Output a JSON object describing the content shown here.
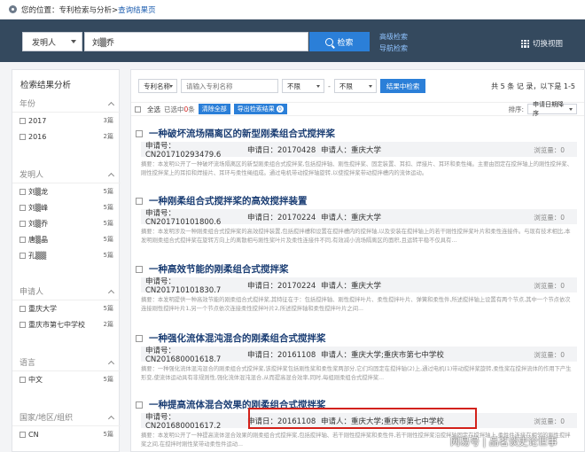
{
  "breadcrumb": {
    "prefix": "您的位置：专利检索与分析>",
    "current": "查询结果页"
  },
  "search": {
    "field": "发明人",
    "query": "刘▒乔",
    "button": "检索",
    "advanced": "高级检索",
    "nav": "导航检索",
    "switch_view": "切换视图"
  },
  "sidebar": {
    "title": "检索结果分析",
    "sections": [
      {
        "name": "年份",
        "items": [
          {
            "label": "2017",
            "count": "3篇"
          },
          {
            "label": "2016",
            "count": "2篇"
          }
        ]
      },
      {
        "name": "发明人",
        "items": [
          {
            "label": "刘▒龙",
            "count": "5篇"
          },
          {
            "label": "刘▒峰",
            "count": "5篇"
          },
          {
            "label": "刘▒乔",
            "count": "5篇"
          },
          {
            "label": "唐▒晶",
            "count": "5篇"
          },
          {
            "label": "孔▒▒",
            "count": "5篇"
          }
        ]
      },
      {
        "name": "申请人",
        "items": [
          {
            "label": "重庆大学",
            "count": "5篇"
          },
          {
            "label": "重庆市第七中学校",
            "count": "2篇"
          }
        ]
      },
      {
        "name": "语言",
        "items": [
          {
            "label": "中文",
            "count": "5篇"
          }
        ]
      },
      {
        "name": "国家/地区/组织",
        "items": [
          {
            "label": "CN",
            "count": "5篇"
          }
        ]
      }
    ]
  },
  "filter": {
    "field": "专利名称",
    "placeholder": "请输入专利名称",
    "from": "不限",
    "to": "不限",
    "dash": "-",
    "button": "结果中检索",
    "summary": "共 5 条 记 录，以下是 1-5"
  },
  "toolbar": {
    "select_all": "全选",
    "selected_prefix": "已选中",
    "selected_count": "0",
    "selected_suffix": "条",
    "clear": "清除全部",
    "export": "导出检索结果",
    "export_badge": "0",
    "sort_label": "排序:",
    "sort_value": "申请日期降序"
  },
  "results": [
    {
      "title": "一种破坏流场隔离区的新型刚柔组合式搅拌桨",
      "app_no": "申请号：CN201710293479.6",
      "app_date": "申请日：20170428",
      "applicant": "申请人：重庆大学",
      "views": "浏览量：0",
      "abstract": "摘要：本发明公开了一种破坏流场隔离区的新型刚柔组合式搅拌桨,包括搅拌轴、刚性搅拌桨、固定装置、耳扣、焊接片、耳环和柔性绳。主要由固定在搅拌轴上的刚性搅拌桨、刚性搅拌桨上的耳扣和焊接片、耳环与柔性绳组成。通过电机带动搅拌轴旋转,以使搅拌桨带动搅拌槽内的流体运动。"
    },
    {
      "title": "一种刚柔组合式搅拌桨的高效搅拌装置",
      "app_no": "申请号：CN201710101800.6",
      "app_date": "申请日：20170224",
      "applicant": "申请人：重庆大学",
      "views": "浏览量：0",
      "abstract": "摘要：本发明涉及一种刚柔组合式搅拌桨的高效搅拌装置,包括搅拌槽和设置在搅拌槽内的搅拌轴,以及安装在搅拌轴上的若干刚性搅拌桨叶片和柔性连接件。与现有技术相比,本发明刚柔组合式搅拌桨在旋转方向上的离散相与刚性桨叶片及柔性连接件不同,有效减小流场隔离区的面积,且运转平稳不仅具有..."
    },
    {
      "title": "一种高效节能的刚柔组合式搅拌桨",
      "app_no": "申请号：CN201710101830.7",
      "app_date": "申请日：20170224",
      "applicant": "申请人：重庆大学",
      "views": "浏览量：0",
      "abstract": "摘要：本发明提供一种高效节能的刚柔组合式搅拌桨,其特征在于：包括搅拌轴、刚性搅拌叶片、柔性搅拌叶片、弹簧和柔性件,所述搅拌轴上设置有两个节点,其中一个节点依次连接刚性搅拌叶片1,另一个节点依次连接柔性搅拌叶片2,所述搅拌轴和柔性搅拌叶片之间..."
    },
    {
      "title": "一种强化流体混沌混合的刚柔组合式搅拌桨",
      "app_no": "申请号：CN201680001618.7",
      "app_date": "申请日：20161108",
      "applicant": "申请人：重庆大学;重庆市第七中学校",
      "views": "浏览量：0",
      "abstract": "摘要：一种强化流体混沌混合的刚柔组合式搅拌桨,该搅拌桨包括刚性桨和柔性桨两部分,它们均固定在搅拌轴(2)上,通过电机(1)带动搅拌桨旋转,柔性桨在搅拌流体的作用下产生形变,使流体运动具有非规则性,强化流体混沌混合,从而提高混合效率,同时,每组刚柔组合式搅拌桨..."
    },
    {
      "title": "一种提高流体混合效果的刚柔组合式搅拌桨",
      "app_no": "申请号：CN201680001617.2",
      "app_date": "申请日：20161108",
      "applicant": "申请人：重庆大学;重庆市第七中学校",
      "views": "浏览量：0",
      "abstract": "摘要：本发明公开了一种提高流体混合效果的刚柔组合式搅拌桨,包括搅拌轴、若干刚性搅拌桨和柔性件,若干刚性搅拌桨沿搅拌轴固定在搅拌轴上,柔性件连接在相邻的刚性搅拌桨之间,在搅拌时刚性桨带动柔性件运动..."
    }
  ],
  "watermark": "网易号 | 品茗谈史论世事"
}
